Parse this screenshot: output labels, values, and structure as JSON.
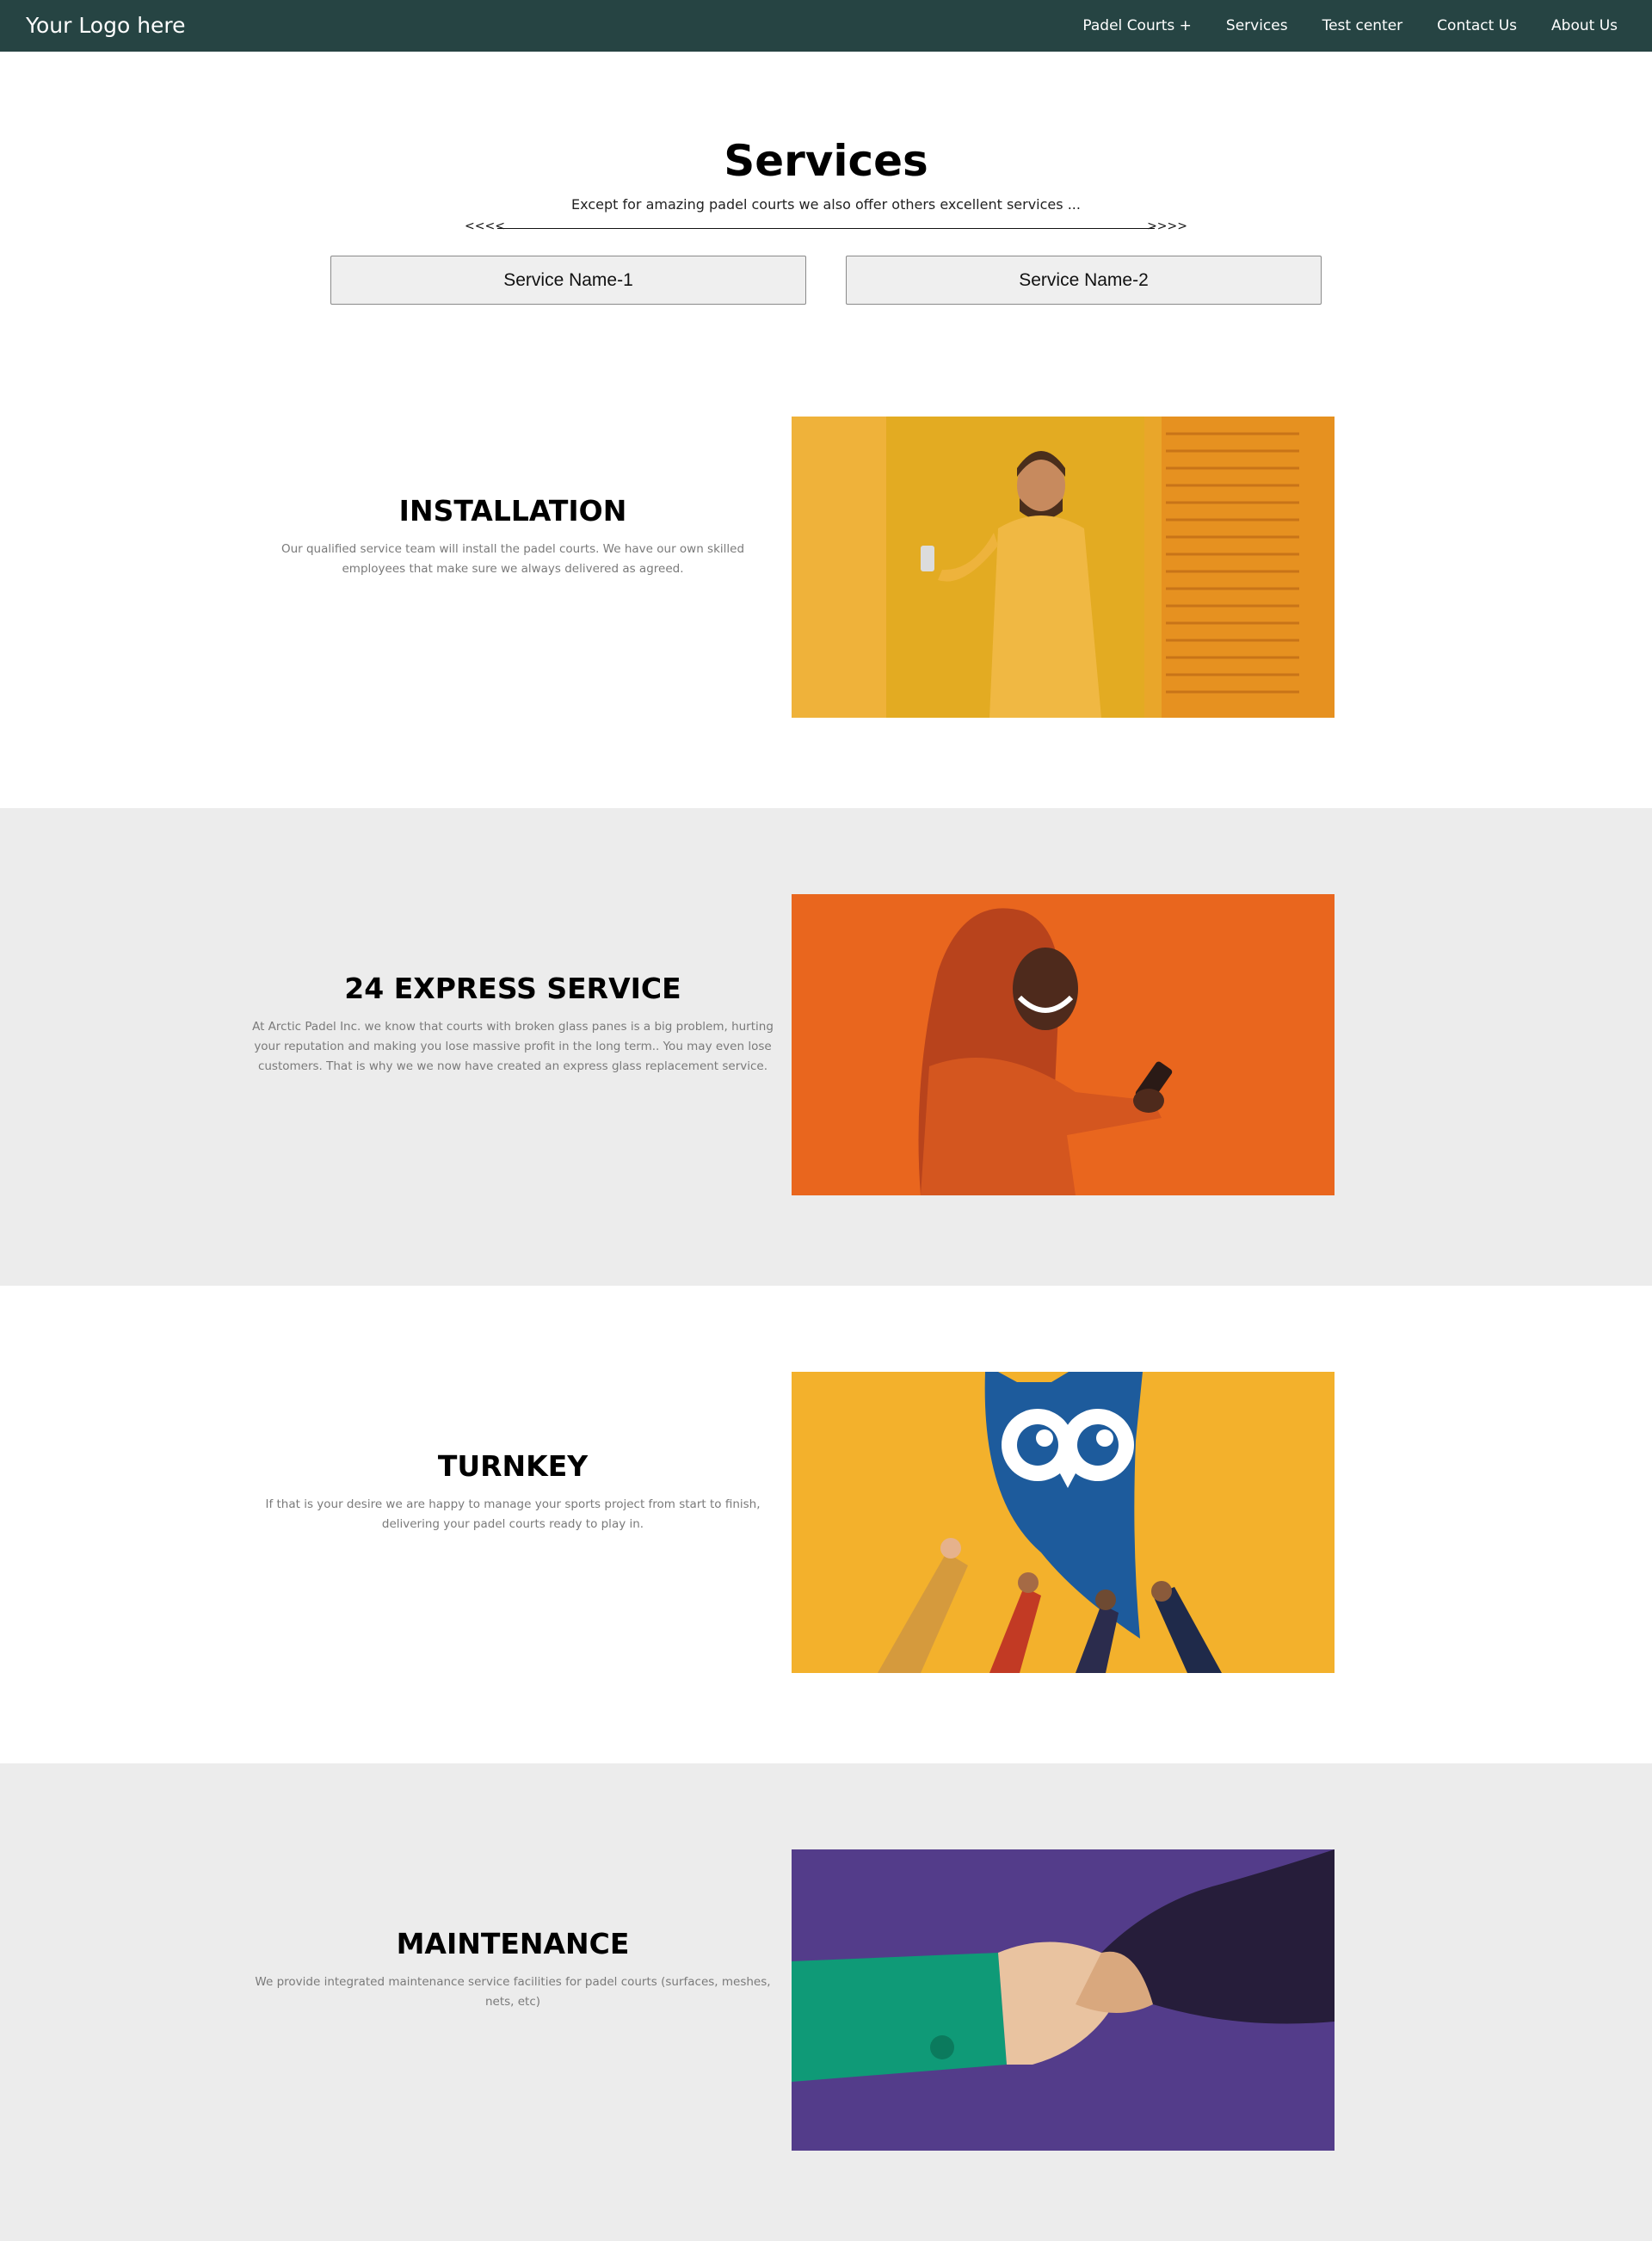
{
  "nav": {
    "logo": "Your Logo here",
    "links": [
      "Padel Courts +",
      "Services",
      "Test center",
      "Contact Us",
      "About Us"
    ]
  },
  "hero": {
    "title": "Services",
    "subtitle": "Except for amazing padel courts we also offer others excellent services ...",
    "divider_left": "<<<<",
    "divider_right": ">>>>",
    "buttons": [
      "Service Name-1",
      "Service Name-2"
    ]
  },
  "sections": [
    {
      "heading": "INSTALLATION",
      "description": "Our qualified service team will install the padel courts. We have our own skilled employees that make sure we always delivered as agreed."
    },
    {
      "heading": "24 EXPRESS SERVICE",
      "description": "At Arctic Padel Inc. we know that courts with broken glass panes is a big problem, hurting your reputation and making you lose massive profit in the long term.. You may even lose customers. That is why we we now have created an express glass replacement service."
    },
    {
      "heading": "TURNKEY",
      "description": "If that is your desire we are happy to manage your sports project from start to finish, delivering your padel courts ready to play in."
    },
    {
      "heading": "MAINTENANCE",
      "description": "We provide integrated maintenance service facilities for padel courts (surfaces, meshes, nets, etc)"
    }
  ],
  "colors": {
    "navbar": "#264443",
    "gray_section": "#ececec",
    "yellow": "#e8a623",
    "orange": "#e9661e",
    "purple": "#533c8a"
  }
}
